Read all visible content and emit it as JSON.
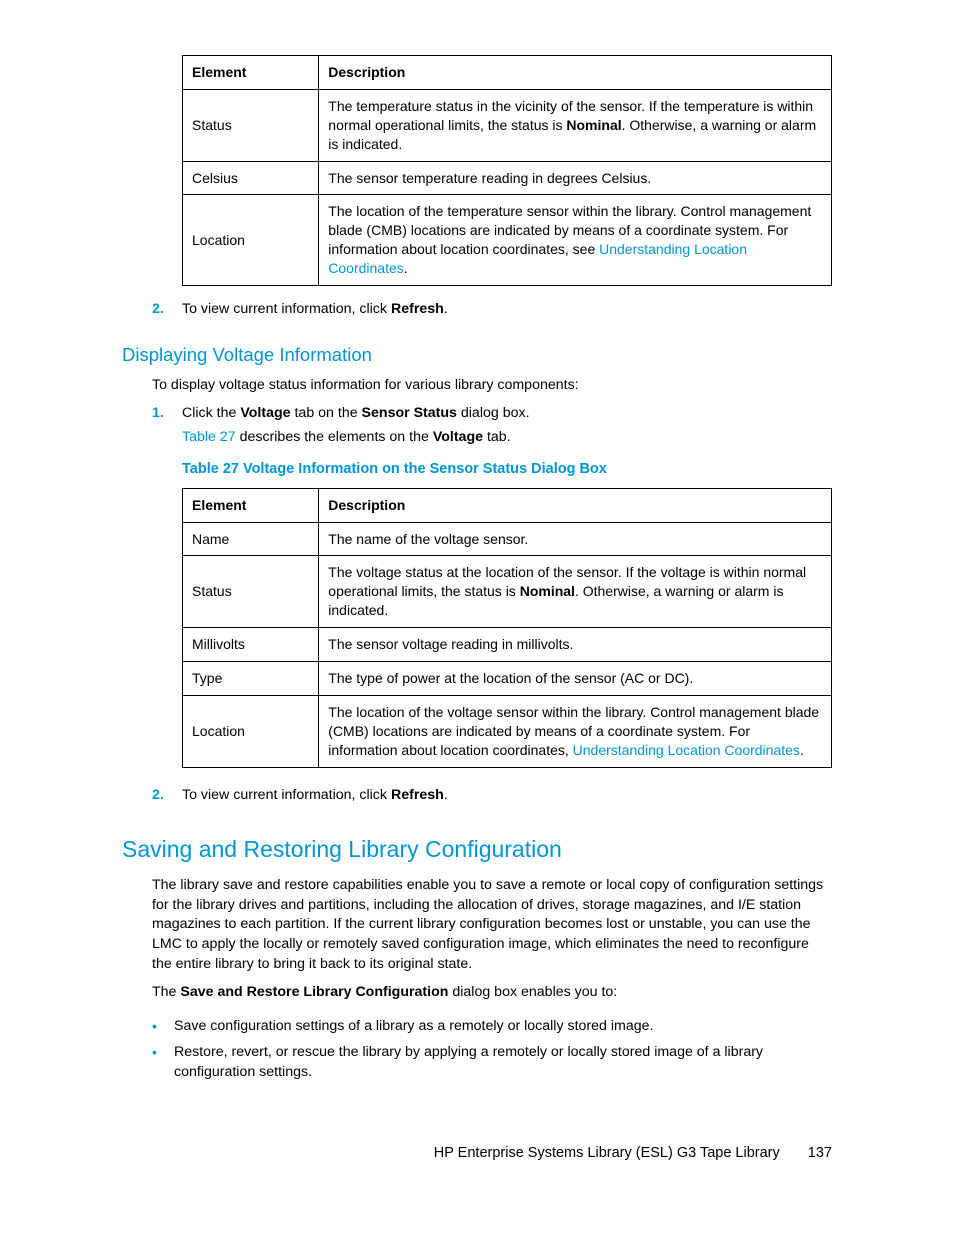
{
  "table1": {
    "h1": "Element",
    "h2": "Description",
    "rows": [
      {
        "el": "Status",
        "d_pre": "The temperature status in the vicinity of the sensor. If the temperature is within normal operational limits, the status is ",
        "d_bold": "Nominal",
        "d_post": ". Otherwise, a warning or alarm is indicated."
      },
      {
        "el": "Celsius",
        "d_pre": "The sensor temperature reading in degrees Celsius.",
        "d_bold": "",
        "d_post": ""
      },
      {
        "el": "Location",
        "d_pre": "The location of the temperature sensor within the library. Control management blade (CMB) locations are indicated by means of a coordinate system. For information about location coordinates, see ",
        "d_link": "Understanding Location Coordinates",
        "d_after": "."
      }
    ]
  },
  "step2a": {
    "num": "2.",
    "pre": "To view current information, click ",
    "bold": "Refresh",
    "post": "."
  },
  "h3_voltage": "Displaying Voltage Information",
  "voltage_intro": "To display voltage status information for various library components:",
  "step1b": {
    "num": "1.",
    "line1_pre": "Click the ",
    "line1_b1": "Voltage",
    "line1_mid": " tab on the ",
    "line1_b2": "Sensor Status",
    "line1_post": " dialog box.",
    "line2_link": "Table 27",
    "line2_mid": " describes the elements on the ",
    "line2_b": "Voltage",
    "line2_post": " tab."
  },
  "table27_caption": "Table 27 Voltage Information on the Sensor Status Dialog Box",
  "table2": {
    "h1": "Element",
    "h2": "Description",
    "rows": [
      {
        "el": "Name",
        "d_pre": "The name of the voltage sensor.",
        "d_bold": "",
        "d_post": ""
      },
      {
        "el": "Status",
        "d_pre": "The voltage status at the location of the sensor. If the voltage is within normal operational limits, the status is ",
        "d_bold": "Nominal",
        "d_post": ". Otherwise, a warning or alarm is indicated."
      },
      {
        "el": "Millivolts",
        "d_pre": "The sensor voltage reading in millivolts.",
        "d_bold": "",
        "d_post": ""
      },
      {
        "el": "Type",
        "d_pre": "The type of power at the location of the sensor (AC or DC).",
        "d_bold": "",
        "d_post": ""
      },
      {
        "el": "Location",
        "d_pre": "The location of the voltage sensor within the library. Control management blade (CMB) locations are indicated by means of a coordinate system. For information about location coordinates, ",
        "d_link": "Understanding Location Coordinates",
        "d_after": "."
      }
    ]
  },
  "step2b": {
    "num": "2.",
    "pre": "To view current information, click ",
    "bold": "Refresh",
    "post": "."
  },
  "h2_save": "Saving and Restoring Library Configuration",
  "save_para1": "The library save and restore capabilities enable you to save a remote or local copy of configuration settings for the library drives and partitions, including the allocation of drives, storage magazines, and I/E station magazines to each partition. If the current library configuration becomes lost or unstable, you can use the LMC to apply the locally or remotely saved configuration image, which eliminates the need to reconfigure the entire library to bring it back to its original state.",
  "save_para2_pre": "The ",
  "save_para2_b": "Save and Restore Library Configuration",
  "save_para2_post": " dialog box enables you to:",
  "bullets": [
    "Save configuration settings of a library as a remotely or locally stored image.",
    "Restore, revert, or rescue the library by applying a remotely or locally stored image of a library configuration settings."
  ],
  "footer_text": "HP Enterprise Systems Library (ESL) G3 Tape Library",
  "footer_page": "137"
}
